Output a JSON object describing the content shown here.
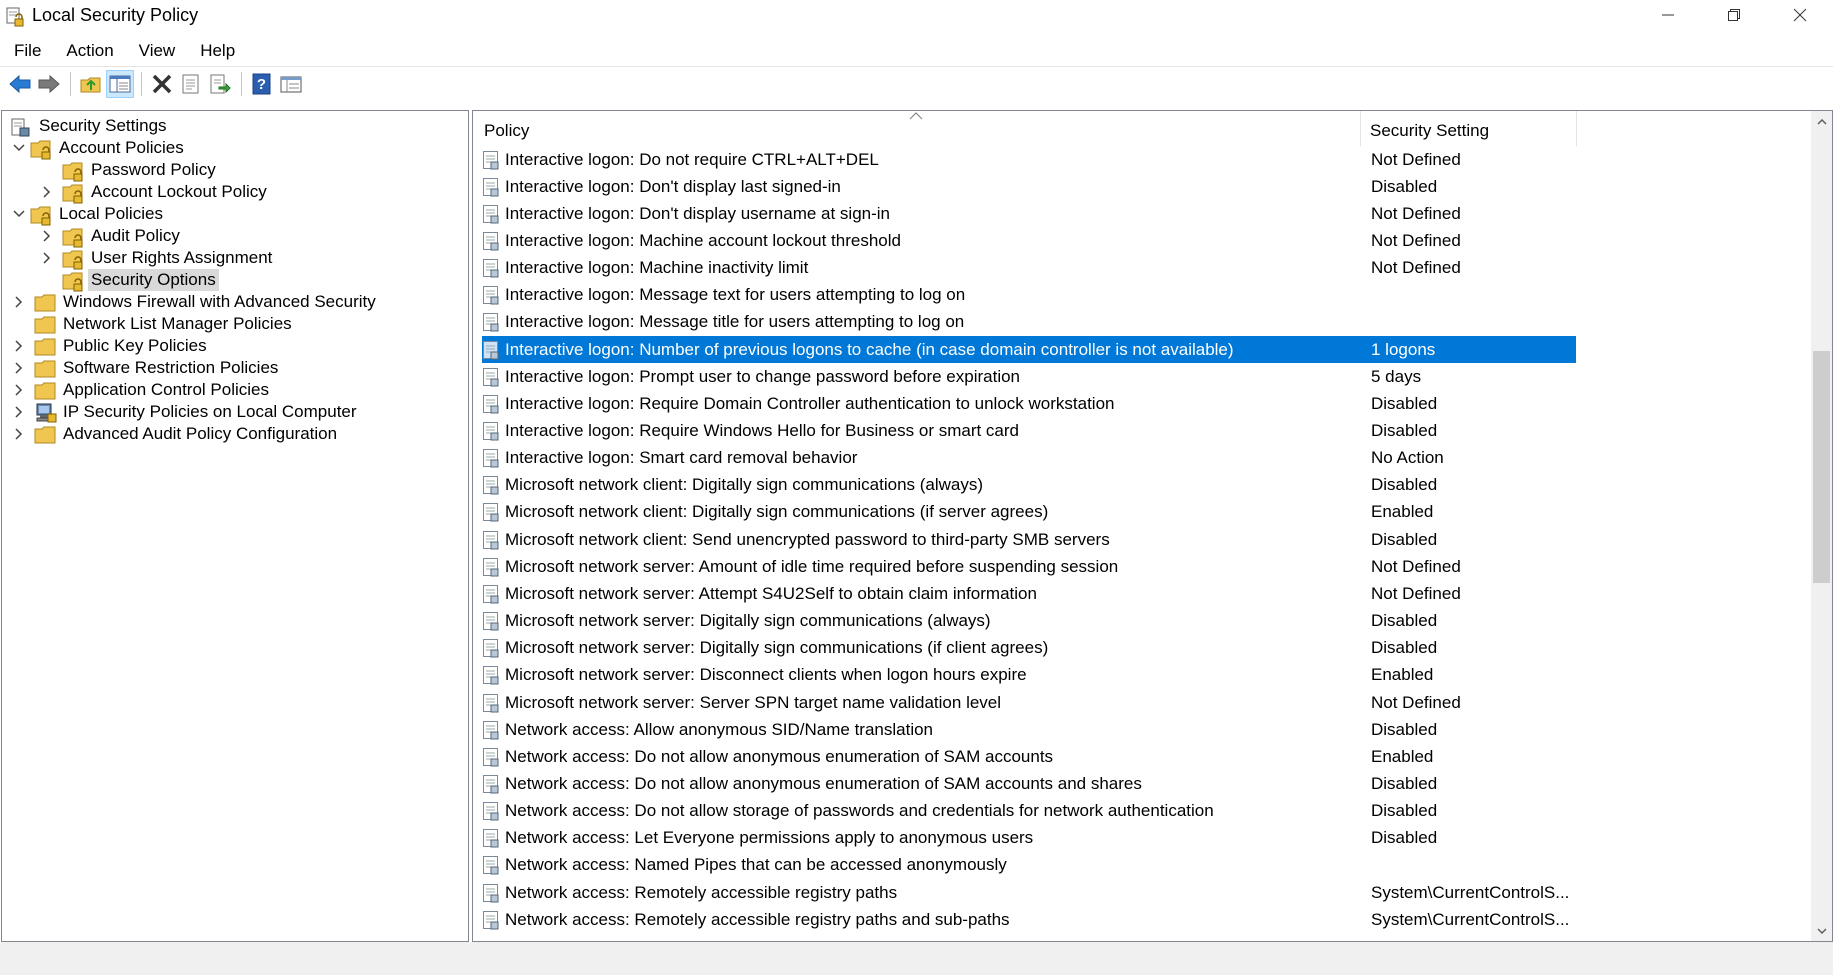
{
  "window": {
    "title": "Local Security Policy",
    "controls": {
      "minimize": "—",
      "restore": "❐",
      "close": "✕"
    }
  },
  "menu": [
    "File",
    "Action",
    "View",
    "Help"
  ],
  "toolbar": {
    "buttons": [
      "back-icon",
      "forward-icon",
      "up-folder-icon",
      "show-hide-tree-icon",
      "delete-icon",
      "properties-icon",
      "export-list-icon",
      "help-icon",
      "details-view-icon"
    ]
  },
  "tree": {
    "items": [
      {
        "label": "Security Settings",
        "chevron": "",
        "icon": "security-settings-icon"
      },
      {
        "label": "Account Policies",
        "chevron": "expanded",
        "icon": "locked-folder-icon"
      },
      {
        "label": "Password Policy",
        "chevron": "",
        "icon": "locked-folder-icon"
      },
      {
        "label": "Account Lockout Policy",
        "chevron": "collapsed",
        "icon": "locked-folder-icon"
      },
      {
        "label": "Local Policies",
        "chevron": "expanded",
        "icon": "locked-folder-icon"
      },
      {
        "label": "Audit Policy",
        "chevron": "collapsed",
        "icon": "locked-folder-icon"
      },
      {
        "label": "User Rights Assignment",
        "chevron": "collapsed",
        "icon": "locked-folder-icon"
      },
      {
        "label": "Security Options",
        "chevron": "",
        "icon": "locked-folder-icon"
      },
      {
        "label": "Windows Firewall with Advanced Security",
        "chevron": "collapsed",
        "icon": "folder-icon"
      },
      {
        "label": "Network List Manager Policies",
        "chevron": "",
        "icon": "folder-icon"
      },
      {
        "label": "Public Key Policies",
        "chevron": "collapsed",
        "icon": "folder-icon"
      },
      {
        "label": "Software Restriction Policies",
        "chevron": "collapsed",
        "icon": "folder-icon"
      },
      {
        "label": "Application Control Policies",
        "chevron": "collapsed",
        "icon": "folder-icon"
      },
      {
        "label": "IP Security Policies on Local Computer",
        "chevron": "collapsed",
        "icon": "ip-security-icon"
      },
      {
        "label": "Advanced Audit Policy Configuration",
        "chevron": "collapsed",
        "icon": "folder-icon"
      }
    ],
    "selected": "Security Options"
  },
  "list": {
    "headers": {
      "policy": "Policy",
      "setting": "Security Setting"
    },
    "sort_indicator": "^",
    "rows": [
      {
        "policy": "Interactive logon: Do not require CTRL+ALT+DEL",
        "setting": "Not Defined"
      },
      {
        "policy": "Interactive logon: Don't display last signed-in",
        "setting": "Disabled"
      },
      {
        "policy": "Interactive logon: Don't display username at sign-in",
        "setting": "Not Defined"
      },
      {
        "policy": "Interactive logon: Machine account lockout threshold",
        "setting": "Not Defined"
      },
      {
        "policy": "Interactive logon: Machine inactivity limit",
        "setting": "Not Defined"
      },
      {
        "policy": "Interactive logon: Message text for users attempting to log on",
        "setting": ""
      },
      {
        "policy": "Interactive logon: Message title for users attempting to log on",
        "setting": ""
      },
      {
        "policy": "Interactive logon: Number of previous logons to cache (in case domain controller is not available)",
        "setting": "1 logons"
      },
      {
        "policy": "Interactive logon: Prompt user to change password before expiration",
        "setting": "5 days"
      },
      {
        "policy": "Interactive logon: Require Domain Controller authentication to unlock workstation",
        "setting": "Disabled"
      },
      {
        "policy": "Interactive logon: Require Windows Hello for Business or smart card",
        "setting": "Disabled"
      },
      {
        "policy": "Interactive logon: Smart card removal behavior",
        "setting": "No Action"
      },
      {
        "policy": "Microsoft network client: Digitally sign communications (always)",
        "setting": "Disabled"
      },
      {
        "policy": "Microsoft network client: Digitally sign communications (if server agrees)",
        "setting": "Enabled"
      },
      {
        "policy": "Microsoft network client: Send unencrypted password to third-party SMB servers",
        "setting": "Disabled"
      },
      {
        "policy": "Microsoft network server: Amount of idle time required before suspending session",
        "setting": "Not Defined"
      },
      {
        "policy": "Microsoft network server: Attempt S4U2Self to obtain claim information",
        "setting": "Not Defined"
      },
      {
        "policy": "Microsoft network server: Digitally sign communications (always)",
        "setting": "Disabled"
      },
      {
        "policy": "Microsoft network server: Digitally sign communications (if client agrees)",
        "setting": "Disabled"
      },
      {
        "policy": "Microsoft network server: Disconnect clients when logon hours expire",
        "setting": "Enabled"
      },
      {
        "policy": "Microsoft network server: Server SPN target name validation level",
        "setting": "Not Defined"
      },
      {
        "policy": "Network access: Allow anonymous SID/Name translation",
        "setting": "Disabled"
      },
      {
        "policy": "Network access: Do not allow anonymous enumeration of SAM accounts",
        "setting": "Enabled"
      },
      {
        "policy": "Network access: Do not allow anonymous enumeration of SAM accounts and shares",
        "setting": "Disabled"
      },
      {
        "policy": "Network access: Do not allow storage of passwords and credentials for network authentication",
        "setting": "Disabled"
      },
      {
        "policy": "Network access: Let Everyone permissions apply to anonymous users",
        "setting": "Disabled"
      },
      {
        "policy": "Network access: Named Pipes that can be accessed anonymously",
        "setting": ""
      },
      {
        "policy": "Network access: Remotely accessible registry paths",
        "setting": "System\\CurrentControlS..."
      },
      {
        "policy": "Network access: Remotely accessible registry paths and sub-paths",
        "setting": "System\\CurrentControlS..."
      }
    ],
    "selected_index": 7
  },
  "colors": {
    "selection": "#0078d7",
    "tree_selection": "#d9d9d9",
    "folder": "#f0c550",
    "lock": "#c8a020"
  }
}
